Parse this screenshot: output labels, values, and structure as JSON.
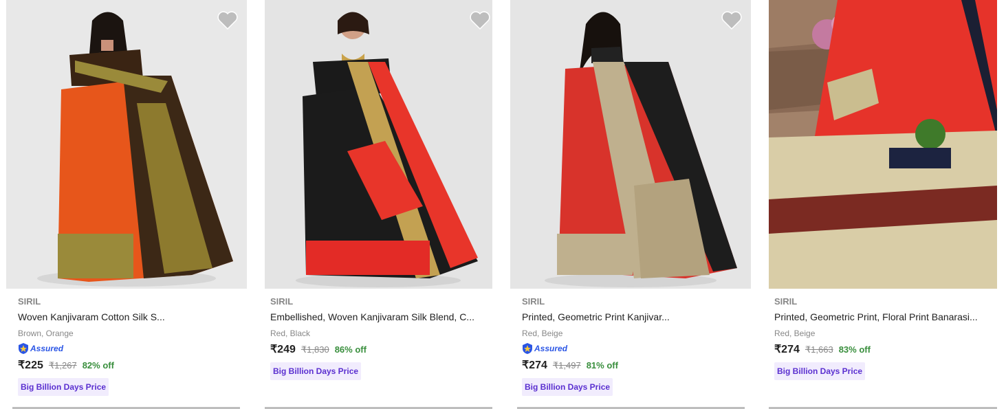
{
  "products": [
    {
      "brand": "SIRIL",
      "title": "Woven Kanjivaram Cotton Silk S...",
      "color": "Brown, Orange",
      "assured": true,
      "assured_label": "Assured",
      "price": "₹225",
      "mrp": "₹1,267",
      "discount": "82% off",
      "badge": "Big Billion Days Price"
    },
    {
      "brand": "SIRIL",
      "title": "Embellished, Woven Kanjivaram Silk Blend, C...",
      "color": "Red, Black",
      "assured": false,
      "price": "₹249",
      "mrp": "₹1,830",
      "discount": "86% off",
      "badge": "Big Billion Days Price"
    },
    {
      "brand": "SIRIL",
      "title": "Printed, Geometric Print Kanjivar...",
      "color": "Red, Beige",
      "assured": true,
      "assured_label": "Assured",
      "price": "₹274",
      "mrp": "₹1,497",
      "discount": "81% off",
      "badge": "Big Billion Days Price"
    },
    {
      "brand": "SIRIL",
      "title": "Printed, Geometric Print, Floral Print Banarasi...",
      "color": "Red, Beige",
      "assured": false,
      "price": "₹274",
      "mrp": "₹1,663",
      "discount": "83% off",
      "badge": "Big Billion Days Price"
    }
  ],
  "colors": {
    "heart": "#bdbdbd",
    "price_off": "#388e3c",
    "badge_bg": "#f1ecfd",
    "badge_text": "#5a2fd0",
    "assured": "#2a55e5"
  },
  "icons": {
    "wishlist": "heart-icon",
    "assured": "assured-shield-icon"
  }
}
